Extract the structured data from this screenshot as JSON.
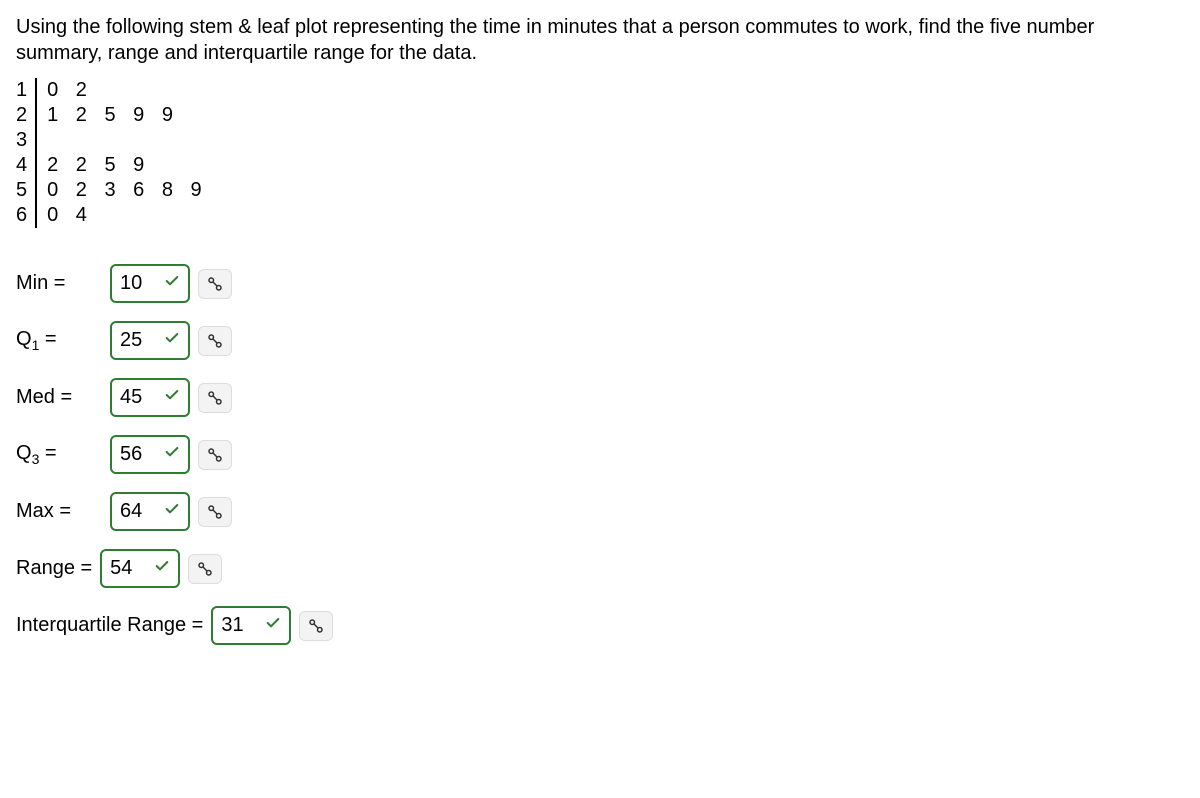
{
  "question": "Using the following stem & leaf plot representing the time in minutes that a person commutes to work, find the five number summary, range and interquartile range for the data.",
  "stemleaf": [
    {
      "stem": "1",
      "leaf": "0 2"
    },
    {
      "stem": "2",
      "leaf": "1 2 5 9 9"
    },
    {
      "stem": "3",
      "leaf": ""
    },
    {
      "stem": "4",
      "leaf": "2 2 5 9"
    },
    {
      "stem": "5",
      "leaf": "0 2 3 6 8 9"
    },
    {
      "stem": "6",
      "leaf": "0 4"
    }
  ],
  "answers": {
    "min": {
      "label": "Min =",
      "value": "10"
    },
    "q1": {
      "label": "Q₁ =",
      "value": "25"
    },
    "med": {
      "label": "Med =",
      "value": "45"
    },
    "q3": {
      "label": "Q₃ =",
      "value": "56"
    },
    "max": {
      "label": "Max =",
      "value": "64"
    },
    "range": {
      "label": "Range =",
      "value": "54"
    },
    "iqr": {
      "label": "Interquartile Range =",
      "value": "31"
    }
  },
  "chart_data": {
    "type": "table",
    "title": "Stem-and-leaf plot: commute time (minutes)",
    "stems": [
      1,
      2,
      3,
      4,
      5,
      6
    ],
    "leaves": [
      [
        0,
        2
      ],
      [
        1,
        2,
        5,
        9,
        9
      ],
      [],
      [
        2,
        2,
        5,
        9
      ],
      [
        0,
        2,
        3,
        6,
        8,
        9
      ],
      [
        0,
        4
      ]
    ],
    "values": [
      10,
      12,
      21,
      22,
      25,
      29,
      29,
      42,
      42,
      45,
      49,
      50,
      52,
      53,
      56,
      58,
      59,
      60,
      64
    ],
    "summary": {
      "min": 10,
      "q1": 25,
      "median": 45,
      "q3": 56,
      "max": 64,
      "range": 54,
      "iqr": 31
    }
  }
}
